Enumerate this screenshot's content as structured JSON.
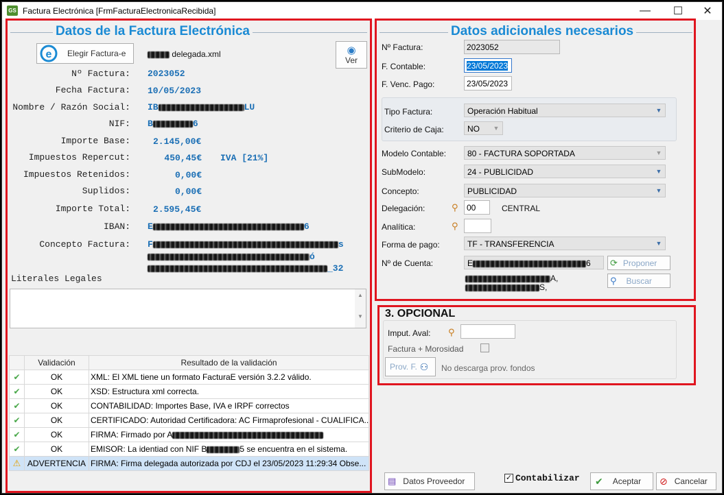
{
  "window": {
    "title": "Factura Electrónica [FrmFacturaElectronicaRecibida]",
    "app_icon": "GS",
    "minimize": "—",
    "maximize": "☐",
    "close": "✕"
  },
  "left": {
    "group_title": "Datos de la Factura Electrónica",
    "choose_button": "Elegir Factura-e",
    "file_name": "delegada.xml",
    "view_button": "Ver",
    "fields": [
      {
        "label": "Nº Factura:",
        "value": "2023052"
      },
      {
        "label": "Fecha Factura:",
        "value": "10/05/2023"
      },
      {
        "label": "Nombre / Razón Social:",
        "value": "IB",
        "value_suffix": "LU"
      },
      {
        "label": "NIF:",
        "value": "B",
        "value_suffix": "6"
      },
      {
        "label": "Importe Base:",
        "value": "2.145,00€"
      },
      {
        "label": "Impuestos Repercut:",
        "value": "450,45€",
        "extra": "IVA [21%]"
      },
      {
        "label": "Impuestos Retenidos:",
        "value": "0,00€"
      },
      {
        "label": "Suplidos:",
        "value": "0,00€"
      },
      {
        "label": "Importe Total:",
        "value": "2.595,45€"
      },
      {
        "label": "IBAN:",
        "value": "E",
        "value_suffix": "6"
      },
      {
        "label": "Concepto Factura:",
        "value": "F",
        "value_suffix": "s"
      }
    ],
    "concept_line2_suffix": "ó",
    "concept_line3_suffix": "_32",
    "literales_label": "Literales Legales",
    "table": {
      "headers": [
        "Validación",
        "Resultado de la validación"
      ],
      "rows": [
        {
          "status_icon": "check-icon",
          "validation": "OK",
          "result": "XML: El XML tiene un formato FacturaE versión 3.2.2 válido."
        },
        {
          "status_icon": "check-icon",
          "validation": "OK",
          "result": "XSD: Estructura xml correcta."
        },
        {
          "status_icon": "check-icon",
          "validation": "OK",
          "result": "CONTABILIDAD: Importes Base, IVA e IRPF correctos"
        },
        {
          "status_icon": "check-icon",
          "validation": "OK",
          "result": "CERTIFICADO:  Autoridad Certificadora: AC Firmaprofesional  -  CUALIFICA..."
        },
        {
          "status_icon": "check-icon",
          "validation": "OK",
          "result": "FIRMA: Firmado por A"
        },
        {
          "status_icon": "check-icon",
          "validation": "OK",
          "result": "EMISOR: La identiad con NIF B",
          "result_suffix": "5 se encuentra en el sistema."
        },
        {
          "status_icon": "warning-icon",
          "validation": "ADVERTENCIA",
          "result": "FIRMA: Firma delegada autorizada por CDJ el 23/05/2023 11:29:34 Obse..."
        }
      ]
    }
  },
  "right": {
    "group_title": "Datos adicionales necesarios",
    "n_factura_label": "Nº Factura:",
    "n_factura_value": "2023052",
    "f_contable_label": "F. Contable:",
    "f_contable_value": "23/05/2023",
    "f_venc_label": "F. Venc. Pago:",
    "f_venc_value": "23/05/2023",
    "tipo_factura_label": "Tipo Factura:",
    "tipo_factura_value": "Operación Habitual",
    "criterio_label": "Criterio de Caja:",
    "criterio_value": "NO",
    "modelo_label": "Modelo Contable:",
    "modelo_value": "80 - FACTURA SOPORTADA",
    "submodelo_label": "SubModelo:",
    "submodelo_value": "24 - PUBLICIDAD",
    "concepto_label": "Concepto:",
    "concepto_value": "PUBLICIDAD",
    "delegacion_label": "Delegación:",
    "delegacion_value": "00",
    "delegacion_name": "CENTRAL",
    "analitica_label": "Analítica:",
    "forma_pago_label": "Forma de pago:",
    "forma_pago_value": "TF - TRANSFERENCIA",
    "cuenta_label": "Nº de Cuenta:",
    "cuenta_value": "E",
    "cuenta_value_suffix": "6",
    "cuenta_line2_suffix": "A,",
    "cuenta_line3_suffix": "S,",
    "proponer_button": "Proponer",
    "buscar_button": "Buscar"
  },
  "opcional": {
    "title": "3. OPCIONAL",
    "imput_label": "Imput. Aval:",
    "morosidad_label": "Factura + Morosidad",
    "prov_button": "Prov. F.",
    "prov_note": "No descarga prov. fondos"
  },
  "footer": {
    "proveedor_button": "Datos Proveedor",
    "contabilizar_label": "Contabilizar",
    "contabilizar_checked": true,
    "aceptar_button": "Aceptar",
    "cancelar_button": "Cancelar"
  },
  "colors": {
    "accent_blue": "#1a8ad4",
    "value_blue": "#1b6fb5",
    "highlight_red": "#e0151f",
    "ok_green": "#4aa84a"
  }
}
